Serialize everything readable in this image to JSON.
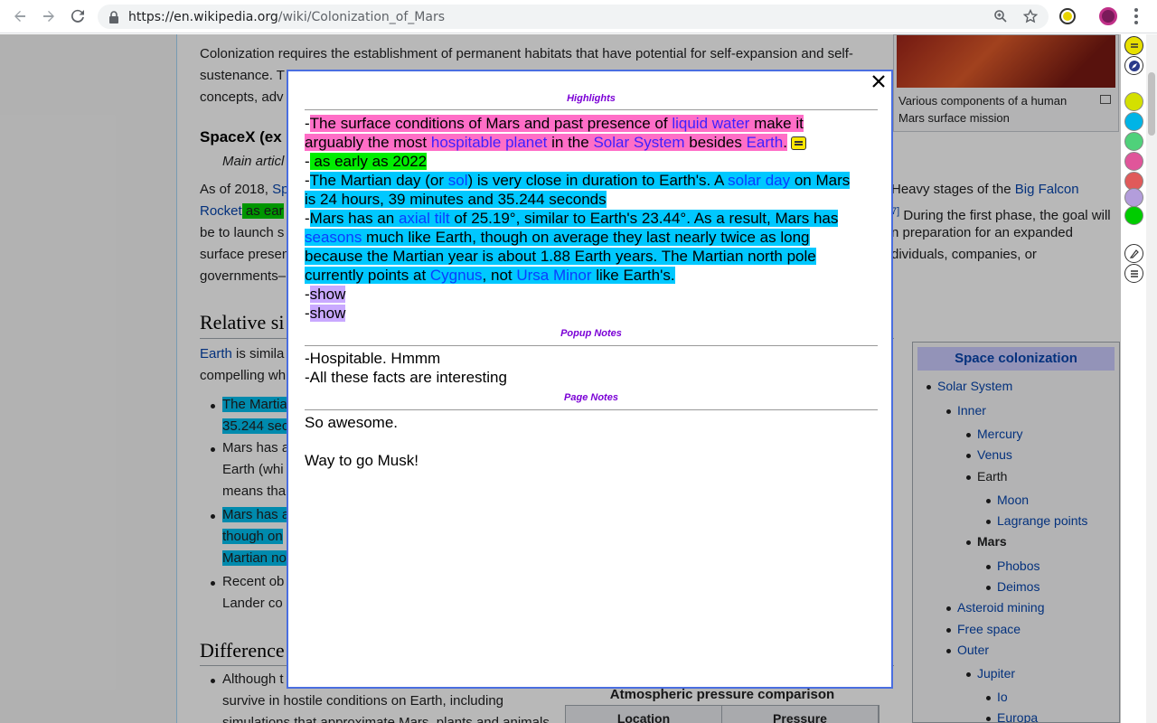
{
  "browser": {
    "url_host": "https://en.wikipedia.org",
    "url_path": "/wiki/Colonization_of_Mars"
  },
  "wiki": {
    "intro_line1": "Colonization requires the establishment of permanent habitats that have potential for self-expansion and self-",
    "intro_line2_start": "sustenance. T",
    "intro_line3_start": "concepts, adv",
    "spacex_heading": "SpaceX (ex",
    "main_article": "Main articl",
    "asof_start": "As of 2018, ",
    "asof_link": "Sp",
    "rocket_link": "Rocket",
    "rocket_hl": " as ear",
    "line_be": "be to launch s",
    "line_surface": "surface presen",
    "line_govt": "governments–",
    "right_heavy": "Heavy stages of the ",
    "right_bigfalcon": "Big Falcon",
    "right_ref": "7]",
    "right_phase": " During the first phase, the goal will",
    "right_prep": "n preparation for an expanded",
    "right_ind": "dividuals, companies, or",
    "relative_heading": "Relative si",
    "earth_link": "Earth",
    "earth_rest": " is simila",
    "compelling": "compelling wh",
    "b1_l1": "The Martia",
    "b1_l2": "35.244 sec",
    "b2_l1": "Mars has a",
    "b2_l2": "Earth (whi",
    "b2_l3": "means tha",
    "b3_l1": "Mars has a",
    "b3_l2": "though on",
    "b3_l3": "Martian no",
    "b4_l1": "Recent ob",
    "b4_l2": "Lander co",
    "difference_heading": "Difference",
    "d1_l1": "Although t",
    "d1_l2": "survive in hostile conditions on Earth, including",
    "d1_l3": "simulations that approximate Mars, plants and animals",
    "s_mark": "s",
    "thumb_caption": "Various components of a human Mars surface mission",
    "atm_caption": "Atmospheric pressure comparison",
    "atm_col1": "Location",
    "atm_col2": "Pressure"
  },
  "navbox": {
    "title": "Space colonization",
    "items": [
      {
        "label": "Solar System"
      },
      {
        "label": "Inner"
      },
      {
        "label": "Mercury"
      },
      {
        "label": "Venus"
      },
      {
        "label": "Earth"
      },
      {
        "label": "Moon"
      },
      {
        "label": "Lagrange points"
      },
      {
        "label": "Mars"
      },
      {
        "label": "Phobos"
      },
      {
        "label": "Deimos"
      },
      {
        "label": "Asteroid mining"
      },
      {
        "label": "Free space"
      },
      {
        "label": "Outer"
      },
      {
        "label": "Jupiter"
      },
      {
        "label": "Io"
      },
      {
        "label": "Europa"
      }
    ]
  },
  "extension": {
    "colors": [
      "#d4e000",
      "#00b4e6",
      "#4fd17a",
      "#e0559a",
      "#e05a5a",
      "#b39ddb",
      "#00cc00"
    ]
  },
  "popup": {
    "close_label": "✕",
    "highlights_heading": "Highlights",
    "h1": {
      "dash": "-",
      "t1": "The surface conditions of Mars and past presence of ",
      "l1": "liquid water",
      "t2": " make it",
      "t3": "arguably the most ",
      "l2": "hospitable planet",
      "t4": " in the ",
      "l3": "Solar System",
      "t5": " besides ",
      "l4": "Earth",
      "t6": "."
    },
    "h2": {
      "dash": "-",
      "text": " as early as 2022"
    },
    "h3": {
      "dash": "-",
      "t1": "The Martian day (or ",
      "l1": "sol",
      "t2": ") is very close in duration to Earth's. A ",
      "l2": "solar day",
      "t3": " on Mars",
      "t4": "is 24 hours, 39 minutes and 35.244 seconds"
    },
    "h4": {
      "dash": "-",
      "t1": "Mars has an ",
      "l1": "axial tilt",
      "t2": " of 25.19°, similar to Earth's 23.44°. As a result, Mars has",
      "l2": "seasons",
      "t3": " much like Earth, though on average they last nearly twice as long",
      "t4": "because the Martian year is about 1.88 Earth years. The Martian north pole",
      "t5": "currently points at ",
      "l3": "Cygnus",
      "t6": ", not ",
      "l4": "Ursa Minor",
      "t7": " like Earth's."
    },
    "h5": {
      "dash": "-",
      "text": "show"
    },
    "h6": {
      "dash": "-",
      "text": "show"
    },
    "popup_notes_heading": "Popup Notes",
    "popup_notes": [
      "-Hospitable. Hmmm",
      "-All these facts are interesting"
    ],
    "page_notes_heading": "Page Notes",
    "page_notes": [
      "So awesome.",
      "Way to go Musk!"
    ]
  }
}
